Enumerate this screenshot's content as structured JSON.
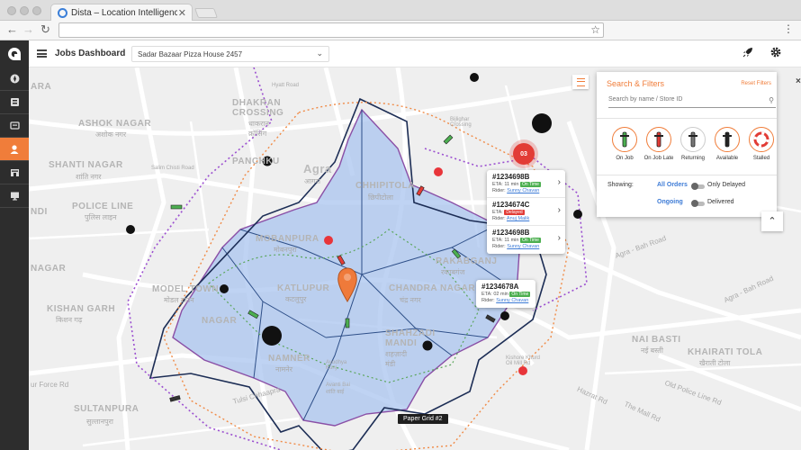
{
  "browser": {
    "tab_title": "Dista – Location Intelligence P",
    "tab_close": "✕",
    "back_icon": "arrow-left-icon",
    "forward_icon": "arrow-right-icon",
    "reload_icon": "reload-icon",
    "star": "☆",
    "menu": "⋮"
  },
  "header": {
    "title": "Jobs Dashboard",
    "store_selected": "Sadar Bazaar Pizza House 2457"
  },
  "sidebar": {
    "items": [
      {
        "icon": "compass-icon"
      },
      {
        "icon": "orders-icon"
      },
      {
        "icon": "list-icon"
      },
      {
        "icon": "rider-icon",
        "active": true
      },
      {
        "icon": "store-icon"
      },
      {
        "icon": "monitor-icon"
      }
    ]
  },
  "map": {
    "labels": [
      "ARA",
      "DHAKRAN\nCROSSING",
      "धाकरान\nक्रॉसिंग",
      "ASHOK NAGAR",
      "अशोक नगर",
      "SHANTI NAGAR",
      "शांति नगर",
      "POLICE LINE",
      "पुलिस लाइन",
      "NDI",
      "PANCHKU",
      "MOBANPURA",
      "मोबनपुरा",
      "CHHIPITOLA",
      "छिपीटोला",
      "KATLUPUR",
      "कटलुपुर",
      "CHANDRA NAGAR",
      "चंद्र नगर",
      "RAKABGANJ",
      "रकाबगंज",
      "MODEL TOWN",
      "मोडल टाउन",
      "KISHAN GARH",
      "किशन गढ़",
      "NAGAR",
      "SHAHZADI\nMANDI",
      "शहज़ादी\nमंडी",
      "NAMNER",
      "नामनेर",
      "SULTANPURA",
      "सुल्तानपुरा",
      "Agra",
      "आगरा",
      "Agra - Bah Road",
      "Agra - Bah Road",
      "NAI BASTI",
      "नई बस्ती",
      "KHAIRATI TOLA",
      "खैराती टोला",
      "ur Force Rd",
      "Ayodhya\nKunj",
      "NAGAR",
      "Kishore Khurd\nOil Mill Rd",
      "Tulsi Chhaapra",
      "Hazrat Rd",
      "Old Police Line Rd",
      "The Mall Rd",
      "Bijlighar\nCrossing",
      "Hyatt Road",
      "Salim Chisti Road",
      "Avanti Bai\nशांति बाई"
    ],
    "paper_label": "Paper Grid #2",
    "cluster_count": "03"
  },
  "jobs_popup": [
    {
      "id": "#1234698B",
      "eta_label": "ETA:",
      "eta": "11 min",
      "status": "On Time",
      "status_color": "#4caf50",
      "rider_label": "Rider:",
      "rider": "Sunny Chavan"
    },
    {
      "id": "#1234674C",
      "eta_label": "ETA:",
      "eta": "",
      "status": "Delayed",
      "status_color": "#e23c36",
      "rider_label": "Rider:",
      "rider": "Anuj Malik"
    },
    {
      "id": "#1234698B",
      "eta_label": "ETA:",
      "eta": "11 min",
      "status": "On Time",
      "status_color": "#4caf50",
      "rider_label": "Rider:",
      "rider": "Sunny Chavan"
    }
  ],
  "job_single": {
    "id": "#1234678A",
    "eta_label": "ETA:",
    "eta": "02 min",
    "status": "On Time",
    "status_color": "#4caf50",
    "rider_label": "Rider:",
    "rider": "Sunny Chavan"
  },
  "filters": {
    "title": "Search & Filters",
    "reset": "Reset Filters",
    "search_placeholder": "Search by name / Store ID",
    "statuses": [
      {
        "label": "On Job",
        "icon": "scooter-green-icon",
        "color": "#4caf50",
        "selected": true
      },
      {
        "label": "On Job Late",
        "icon": "scooter-red-icon",
        "color": "#e23c36",
        "selected": true
      },
      {
        "label": "Returning",
        "icon": "scooter-grey-icon",
        "color": "#666666",
        "selected": false
      },
      {
        "label": "Available",
        "icon": "scooter-black-icon",
        "color": "#222222",
        "selected": true
      },
      {
        "label": "Stalled",
        "icon": "lifebuoy-icon",
        "color": "#e23c36",
        "selected": true
      }
    ],
    "showing_label": "Showing:",
    "all_orders": "All Orders",
    "only_delayed": "Only Delayed",
    "ongoing": "Ongoing",
    "delivered": "Delivered"
  },
  "colors": {
    "accent": "#f07d3a",
    "link": "#3d7bd6",
    "zone_fill": "#a9c4ef",
    "boundary": "#1c2d55"
  }
}
